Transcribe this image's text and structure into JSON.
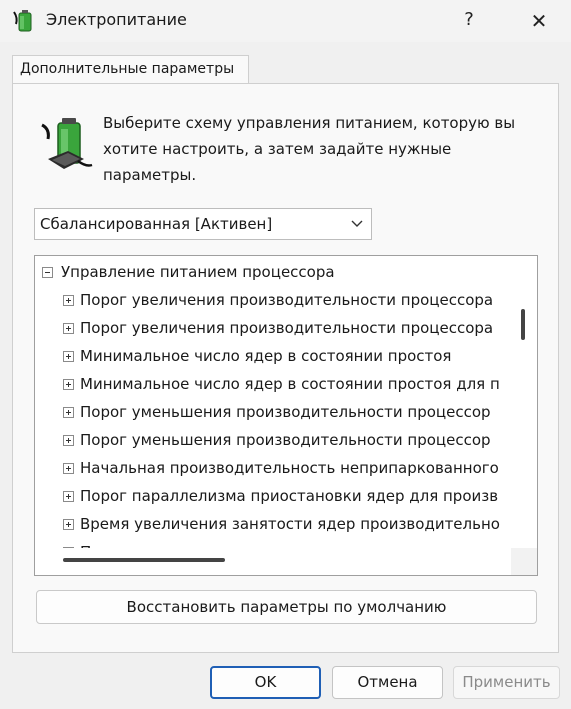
{
  "window": {
    "title": "Электропитание",
    "help_label": "?",
    "close_label": "✕"
  },
  "tab": {
    "label": "Дополнительные параметры"
  },
  "intro": {
    "text": "Выберите схему управления питанием, которую вы хотите настроить, а затем задайте нужные параметры.",
    "icon": "battery-plug-icon"
  },
  "scheme_select": {
    "value": "Сбалансированная [Активен]"
  },
  "tree": {
    "group_label": "Управление питанием процессора",
    "items": [
      {
        "label": "Порог увеличения производительности процессора"
      },
      {
        "label": "Порог увеличения производительности процессора"
      },
      {
        "label": "Минимальное число ядер в состоянии простоя"
      },
      {
        "label": "Минимальное число ядер в состоянии простоя для п"
      },
      {
        "label": "Порог уменьшения производительности процессор"
      },
      {
        "label": "Порог уменьшения производительности процессор"
      },
      {
        "label": "Начальная производительность неприпаркованного"
      },
      {
        "label": "Порог параллелизма приостановки ядер для произв"
      },
      {
        "label": "Время увеличения занятости ядер производительно"
      },
      {
        "label": "П"
      }
    ]
  },
  "buttons": {
    "restore": "Восстановить параметры по умолчанию",
    "ok": "OK",
    "cancel": "Отмена",
    "apply": "Применить"
  },
  "colors": {
    "accent": "#1f5fb5",
    "battery_green": "#3aa53c"
  }
}
